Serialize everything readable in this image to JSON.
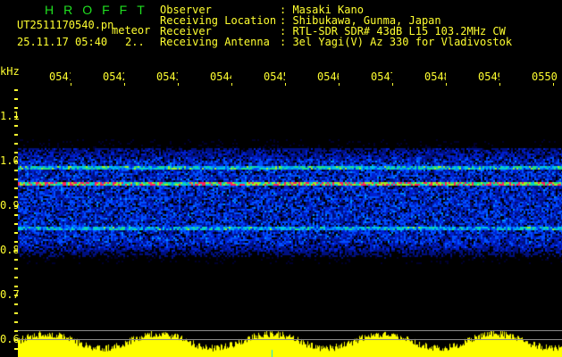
{
  "title": "HROFFT",
  "file_name": "UT2511170540.pn",
  "mode": "meteor",
  "datetime": "25.11.17 05:40",
  "count": "2..",
  "info": [
    {
      "label": "Observer",
      "value": "Masaki Kano"
    },
    {
      "label": "Receiving Location",
      "value": "Shibukawa, Gunma, Japan"
    },
    {
      "label": "Receiver",
      "value": "RTL-SDR SDR# 43dB L15 103.2MHz CW"
    },
    {
      "label": "Receiving Antenna",
      "value": "3el Yagi(V) Az 330 for Vladivostok"
    }
  ],
  "y_unit": "kHz",
  "y_labels": [
    "1.1",
    "1.0",
    "0.9",
    "0.8",
    "0.7",
    "0.6"
  ],
  "time_labels": [
    "0541",
    "0542",
    "0543",
    "0544",
    "0545",
    "0546",
    "0547",
    "0548",
    "0549",
    "0550"
  ],
  "colors": {
    "text": "#ffff30",
    "title": "#20e020",
    "signal": "#ff2060"
  }
}
